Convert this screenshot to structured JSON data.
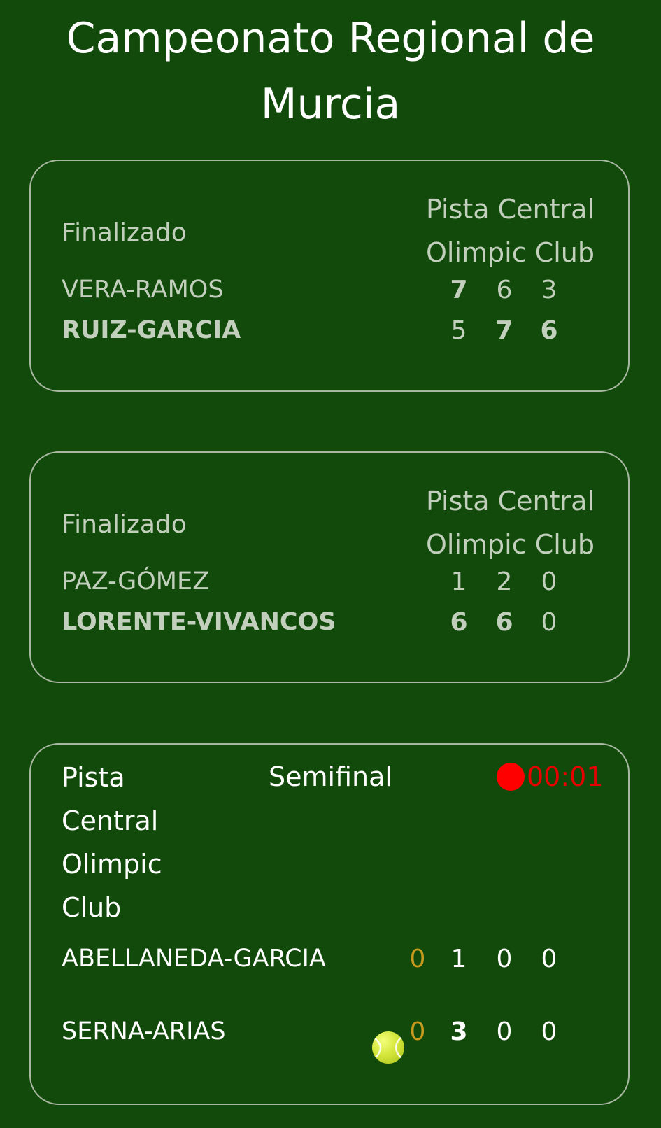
{
  "header": {
    "title": "Campeonato Regional de Murcia"
  },
  "matches": [
    {
      "status": "Finalizado",
      "venue_line1": "Pista Central",
      "venue_line2": "Olimpic Club",
      "team1": {
        "name": "VERA-RAMOS",
        "sets": [
          "7",
          "6",
          "3"
        ]
      },
      "team2": {
        "name": "RUIZ-GARCIA",
        "sets": [
          "5",
          "7",
          "6"
        ]
      }
    },
    {
      "status": "Finalizado",
      "venue_line1": "Pista Central",
      "venue_line2": "Olimpic Club",
      "team1": {
        "name": "PAZ-GÓMEZ",
        "sets": [
          "1",
          "2",
          "0"
        ]
      },
      "team2": {
        "name": "LORENTE-VIVANCOS",
        "sets": [
          "6",
          "6",
          "0"
        ]
      }
    }
  ],
  "live_match": {
    "venue": "Pista Central Olimpic Club",
    "round": "Semifinal",
    "timer": "00:01",
    "team1": {
      "name": "ABELLANEDA-GARCIA",
      "points": "0",
      "sets": [
        "1",
        "0",
        "0"
      ]
    },
    "team2": {
      "name": "SERNA-ARIAS",
      "points": "0",
      "sets": [
        "3",
        "0",
        "0"
      ],
      "serving": true
    }
  },
  "icons": {
    "live_indicator": "recording-dot-icon",
    "serve_indicator": "tennis-ball-icon"
  },
  "colors": {
    "background": "#124a0b",
    "live_red": "#e60000",
    "points_gold": "#c79a1e"
  }
}
